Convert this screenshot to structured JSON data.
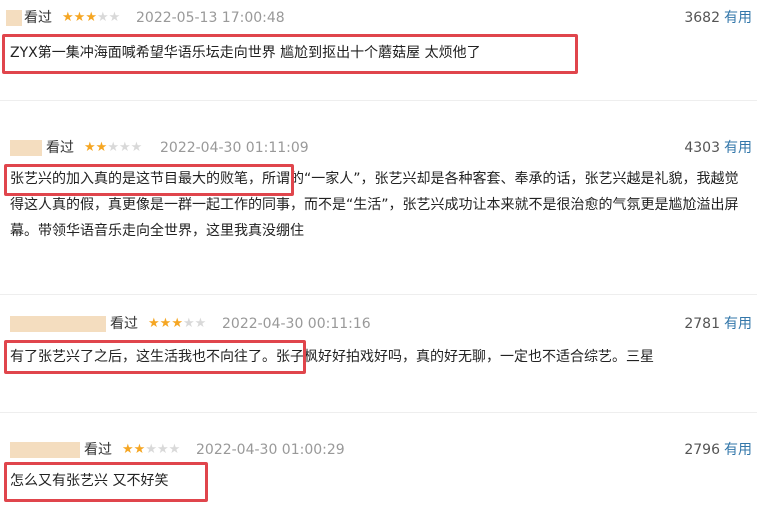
{
  "reviews": [
    {
      "watched": "看过",
      "stars": 3,
      "time": "2022-05-13 17:00:48",
      "votes": "3682",
      "useful": "有用",
      "highlight_text": "ZYX第一集冲海面喊希望华语乐坛走向世界 尴尬到抠出十个蘑菇屋 太烦他了",
      "rest_text": ""
    },
    {
      "watched": "看过",
      "stars": 2,
      "time": "2022-04-30 01:11:09",
      "votes": "4303",
      "useful": "有用",
      "highlight_text": "张艺兴的加入真的是这节目最大的败笔，",
      "rest_text": "所谓的“一家人”，张艺兴却是各种客套、奉承的话，张艺兴越是礼貌，我越觉得这人真的假，真更像是一群一起工作的同事，而不是“生活”，张艺兴成功让本来就不是很治愈的气氛更是尴尬溢出屏幕。带领华语音乐走向全世界，这里我真没绷住"
    },
    {
      "watched": "看过",
      "stars": 3,
      "time": "2022-04-30 00:11:16",
      "votes": "2781",
      "useful": "有用",
      "highlight_text": "有了张艺兴了之后，这生活我也不向往了。",
      "rest_text": "张子枫好好拍戏好吗，真的好无聊，一定也不适合综艺。三星"
    },
    {
      "watched": "看过",
      "stars": 2,
      "time": "2022-04-30 01:00:29",
      "votes": "2796",
      "useful": "有用",
      "highlight_text": "怎么又有张艺兴 又不好笑",
      "rest_text": ""
    }
  ]
}
